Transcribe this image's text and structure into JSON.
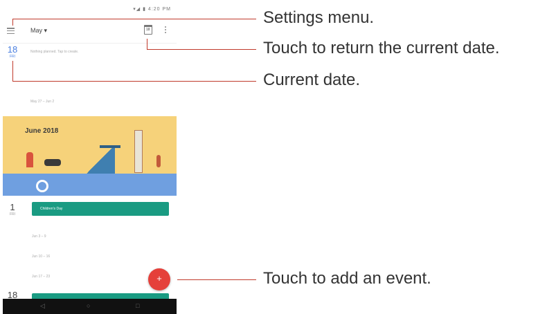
{
  "status_bar": {
    "icons": "▾◢ ▮ 4:20 PM"
  },
  "app_bar": {
    "month": "May ▾"
  },
  "today": {
    "day": "18",
    "weekday": "FRI",
    "reminder": "Nothing planned. Tap to create."
  },
  "weeks": {
    "w1": "May 27 – Jun 2",
    "w2": "Jun 3 – 9",
    "w3": "Jun 10 – 16",
    "w4": "Jun 17 – 23"
  },
  "banner": {
    "title": "June 2018"
  },
  "event_day": {
    "day": "1",
    "weekday": "FRI",
    "event": "Children's Day"
  },
  "bottom_day": {
    "day": "18"
  },
  "fab": {
    "symbol": "+"
  },
  "nav": {
    "back": "◁",
    "home": "○",
    "recents": "□"
  },
  "callouts": {
    "settings": "Settings menu.",
    "return_today": "Touch to return the current date.",
    "current_date": "Current date.",
    "add_event": "Touch to add an event."
  },
  "colors": {
    "accent_blue": "#4a7fe0",
    "event_green": "#1a9b82",
    "fab_red": "#e5403a",
    "callout_line": "#c0392b"
  }
}
